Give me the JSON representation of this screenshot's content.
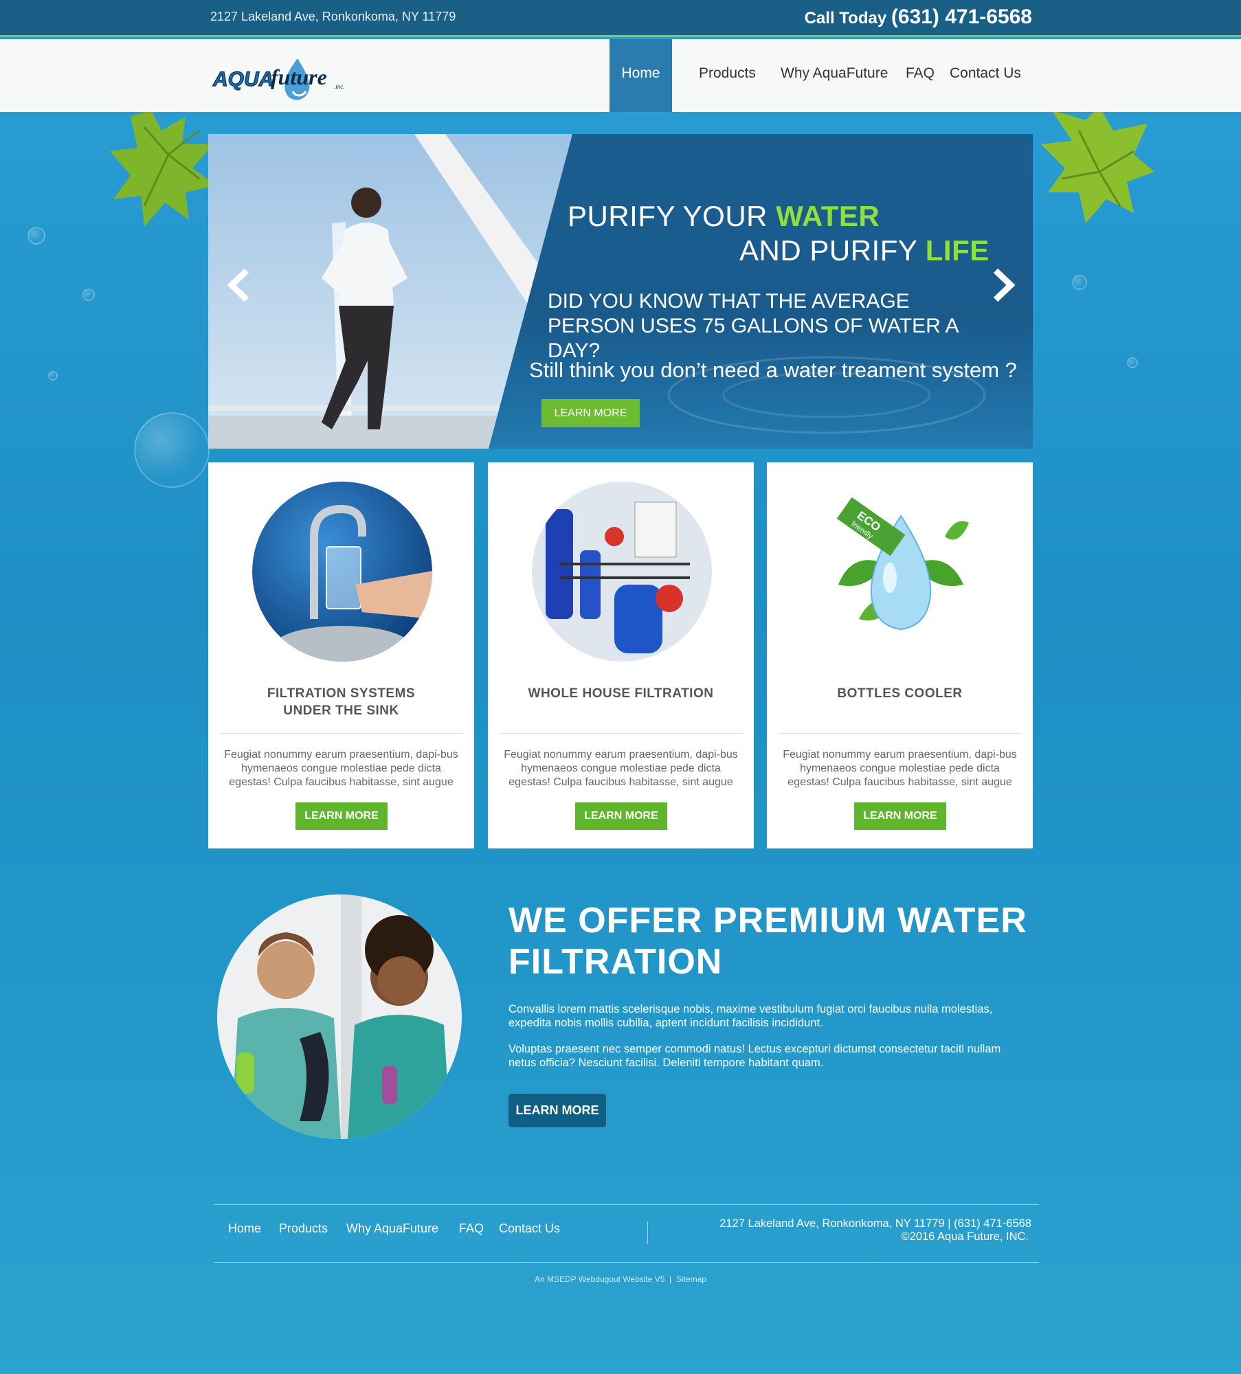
{
  "topbar": {
    "address": "2127  Lakeland Ave, Ronkonkoma, NY 11779",
    "call_label": "Call Today",
    "phone": "(631) 471-6568"
  },
  "brand": {
    "logo_main": "AQUA",
    "logo_script": "future",
    "logo_suffix": ".inc."
  },
  "nav": {
    "items": [
      {
        "label": "Home",
        "active": true
      },
      {
        "label": "Products"
      },
      {
        "label": "Why AquaFuture"
      },
      {
        "label": "FAQ"
      },
      {
        "label": "Contact Us"
      }
    ]
  },
  "hero": {
    "line1_a": "PURIFY YOUR ",
    "line1_b": "WATER",
    "line2_a": "AND PURIFY ",
    "line2_b": "LIFE",
    "question": "DID YOU KNOW THAT THE AVERAGE PERSON USES 75 GALLONS OF WATER A DAY?",
    "still": "Still think you don’t need a water treament system ?",
    "button": "LEARN MORE"
  },
  "cards": [
    {
      "title_line1": "FILTRATION SYSTEMS",
      "title_line2": "UNDER THE SINK",
      "description": "Feugiat nonummy earum praesentium, dapi-bus hymenaeos congue molestiae pede dicta egestas! Culpa faucibus habitasse, sint augue",
      "button": "LEARN MORE"
    },
    {
      "title_line1": "WHOLE HOUSE FILTRATION",
      "title_line2": "",
      "description": "Feugiat nonummy earum praesentium, dapi-bus hymenaeos congue molestiae pede dicta egestas! Culpa faucibus habitasse, sint augue",
      "button": "LEARN MORE"
    },
    {
      "title_line1": "BOTTLES COOLER",
      "title_line2": "",
      "description": "Feugiat nonummy earum praesentium, dapi-bus hymenaeos congue molestiae pede dicta egestas! Culpa faucibus habitasse, sint augue",
      "button": "LEARN MORE",
      "badge_top": "ECO",
      "badge_bottom": "friendly"
    }
  ],
  "offer": {
    "title": "WE OFFER PREMIUM WATER FILTRATION",
    "p1": "Convallis lorem mattis scelerisque nobis, maxime vestibulum fugiat orci faucibus nulla molestias, expedita nobis mollis cubilia, aptent incidunt facilisis incididunt.",
    "p2": "Voluptas praesent nec semper commodi natus! Lectus excepturi dictumst consectetur taciti nullam netus officia? Nesciunt facilisi. Deleniti tempore habitant quam.",
    "button": "LEARN MORE"
  },
  "footer": {
    "nav": [
      "Home",
      "Products",
      "Why AquaFuture",
      "FAQ",
      "Contact Us"
    ],
    "info_line1": "2127  Lakeland Ave, Ronkonkoma, NY 11779 | (631) 471-6568",
    "info_line2": "©2016  Aqua Future, INC.",
    "credit": "An MSEDP Webdugout Website V5",
    "credit_sep": "|",
    "sitemap": "Sitemap"
  },
  "colors": {
    "topbar": "#1a5f86",
    "accent_green": "#6cbd31",
    "nav_active": "#2a7bb0",
    "hero_panel": "#1a5c8e",
    "offer_button": "#0f5f85"
  },
  "icons": [
    "chevron-left-icon",
    "chevron-right-icon",
    "maple-leaf-icon",
    "water-drop-icon"
  ]
}
